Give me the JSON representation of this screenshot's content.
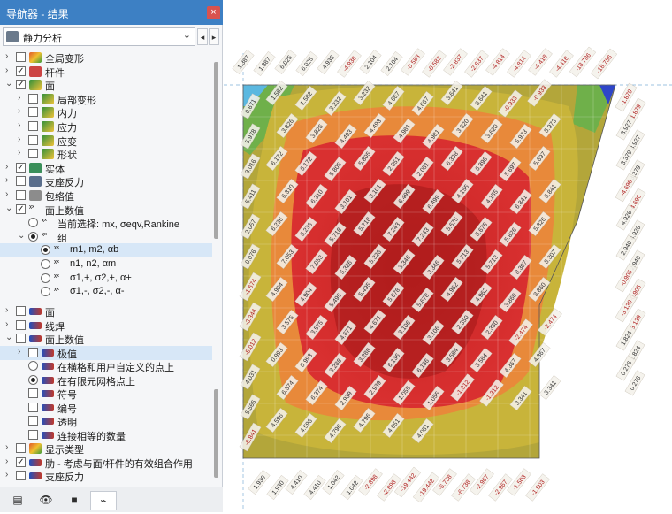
{
  "window": {
    "title": "导航器 - 结果",
    "close_glyph": "×"
  },
  "combo": {
    "value": "静力分析",
    "dropdown_glyph": "⌄",
    "prev_glyph": "◂",
    "next_glyph": "▸"
  },
  "tree_top": [
    {
      "label": "全局变形",
      "exp": "›",
      "check": "",
      "icon": "grid"
    },
    {
      "label": "杆件",
      "exp": "›",
      "check": "✓",
      "icon": "mem"
    },
    {
      "label": "面",
      "exp": "⌄",
      "check": "✓",
      "icon": "face"
    },
    {
      "label": "局部变形",
      "exp": "›",
      "check": "",
      "icon": "face"
    },
    {
      "label": "内力",
      "exp": "›",
      "check": "",
      "icon": "face"
    },
    {
      "label": "应力",
      "exp": "›",
      "check": "",
      "icon": "face"
    },
    {
      "label": "应变",
      "exp": "›",
      "check": "",
      "icon": "face"
    },
    {
      "label": "形状",
      "exp": "›",
      "check": "",
      "icon": "face"
    },
    {
      "label": "实体",
      "exp": "›",
      "check": "✓",
      "icon": "solid"
    },
    {
      "label": "支座反力",
      "exp": "›",
      "check": "",
      "icon": "sup"
    },
    {
      "label": "包络值",
      "exp": "›",
      "check": "",
      "icon": "env"
    },
    {
      "label": "面上数值",
      "exp": "⌄",
      "check": "✓",
      "icon": "xx"
    },
    {
      "label": "当前选择: mx, σeqv,Rankine",
      "exp": "",
      "radio": "off",
      "icon": "xx"
    },
    {
      "label": "组",
      "exp": "⌄",
      "radio": "on",
      "icon": "xx"
    },
    {
      "label": "m1, m2, αb",
      "exp": "",
      "radio": "on",
      "icon": "xx",
      "selected": true
    },
    {
      "label": "n1, n2, αm",
      "exp": "",
      "radio": "off",
      "icon": "xx"
    },
    {
      "label": "σ1,+, σ2,+, α+",
      "exp": "",
      "radio": "off",
      "icon": "xx"
    },
    {
      "label": "σ1,-, σ2,-, α-",
      "exp": "",
      "radio": "off",
      "icon": "xx"
    }
  ],
  "tree_bottom": [
    {
      "label": "面",
      "exp": "›",
      "check": "",
      "icon": "pen"
    },
    {
      "label": "线焊",
      "exp": "›",
      "check": "",
      "icon": "pen"
    },
    {
      "label": "面上数值",
      "exp": "⌄",
      "check": "",
      "icon": "pen"
    },
    {
      "label": "极值",
      "exp": "›",
      "check": "",
      "icon": "pen",
      "selected": true
    },
    {
      "label": "在横格和用户自定义的点上",
      "exp": "",
      "radio": "off",
      "icon": "pen"
    },
    {
      "label": "在有限元网格点上",
      "exp": "",
      "radio": "on",
      "icon": "pen"
    },
    {
      "label": "符号",
      "exp": "",
      "check": "",
      "icon": "pen"
    },
    {
      "label": "编号",
      "exp": "",
      "check": "",
      "icon": "pen"
    },
    {
      "label": "透明",
      "exp": "",
      "check": "",
      "icon": "pen"
    },
    {
      "label": "连接相等的数量",
      "exp": "",
      "check": "",
      "icon": "pen"
    },
    {
      "label": "显示类型",
      "exp": "›",
      "check": "",
      "icon": "grid"
    },
    {
      "label": "肋 - 考虑与面/杆件的有效组合作用",
      "exp": "›",
      "check": "✓",
      "icon": "pen"
    },
    {
      "label": "支座反力",
      "exp": "›",
      "check": "",
      "icon": "pen"
    }
  ],
  "bottom_tabs": [
    {
      "name": "data-tab-icon",
      "glyph": "▤"
    },
    {
      "name": "view-tab-icon",
      "glyph": "👁"
    },
    {
      "name": "video-tab-icon",
      "glyph": "■"
    },
    {
      "name": "results-tab-icon",
      "glyph": "⌁"
    }
  ],
  "colors": {
    "titlebar": "#3d80c4",
    "contour_red_dark": "#a01818",
    "contour_red": "#d93030",
    "contour_orange": "#e8893a",
    "contour_yellow": "#c8b43a",
    "contour_olive": "#b3a63a",
    "contour_green": "#6fb04a",
    "contour_blue": "#2e46c9"
  },
  "value_labels": {
    "top_edge": [
      "1.387",
      "1.387",
      "6.025",
      "6.025",
      "4.938",
      "-4.938",
      "2.104",
      "2.104",
      "-0.583",
      "-0.583",
      "-2.837",
      "-2.837",
      "-4.814",
      "-4.814",
      "-4.418",
      "-4.418",
      "-18.786",
      "-18.786"
    ],
    "right_edge": [
      "-1.879",
      "-1.879",
      "3.927",
      "3.927",
      "3.379",
      "3.379",
      "-4.696",
      "-4.696",
      "4.926",
      "4.926",
      "2.940",
      "2.940",
      "-0.905",
      "-0.905",
      "-3.139",
      "-3.139",
      "1.824",
      "1.824",
      "0.276",
      "0.276"
    ],
    "bottom_edge": [
      "1.930",
      "1.930",
      "4.410",
      "4.410",
      "1.042",
      "1.042",
      "-2.898",
      "-2.898",
      "-19.442",
      "-19.442",
      "-6.738",
      "-6.738",
      "-2.967",
      "-2.967",
      "-1.503",
      "-1.503"
    ],
    "left_edge": [
      "0.671",
      "5.978",
      "3.016",
      "5.411",
      "2.057",
      "0.076",
      "-1.674",
      "-3.344",
      "-5.012",
      "4.031",
      "5.565",
      "-6.841"
    ],
    "interior": [
      "1.582",
      "1.582",
      "3.232",
      "3.232",
      "4.667",
      "4.667",
      "3.641",
      "3.641",
      "-0.933",
      "-0.933",
      "3.826",
      "3.826",
      "4.493",
      "4.493",
      "4.981",
      "4.981",
      "3.620",
      "3.620",
      "5.973",
      "5.973",
      "6.172",
      "6.172",
      "5.805",
      "5.805",
      "2.051",
      "2.051",
      "6.398",
      "6.398",
      "5.697",
      "5.697",
      "6.310",
      "6.310",
      "3.101",
      "3.101",
      "6.499",
      "6.499",
      "4.155",
      "4.155",
      "6.841",
      "6.841",
      "6.236",
      "6.236",
      "5.718",
      "5.718",
      "7.243",
      "7.243",
      "5.675",
      "5.675",
      "5.826",
      "5.826",
      "7.053",
      "7.053",
      "5.326",
      "5.326",
      "3.346",
      "3.346",
      "5.713",
      "5.713",
      "8.307",
      "8.307",
      "4.904",
      "4.904",
      "5.495",
      "5.495",
      "5.678",
      "5.678",
      "4.962",
      "4.962",
      "3.860",
      "3.860",
      "3.575",
      "3.575",
      "4.671",
      "4.671",
      "3.106",
      "3.106",
      "2.350",
      "2.350",
      "-2.474",
      "-2.474",
      "0.993",
      "0.993",
      "3.288",
      "3.288",
      "6.136",
      "6.136",
      "3.584",
      "3.584",
      "4.367",
      "4.367",
      "6.374",
      "6.374",
      "2.939",
      "2.939",
      "1.055",
      "1.055",
      "-1.312",
      "-1.312",
      "3.341",
      "3.341",
      "4.596",
      "4.596",
      "4.796",
      "4.796",
      "4.051",
      "4.051"
    ]
  }
}
